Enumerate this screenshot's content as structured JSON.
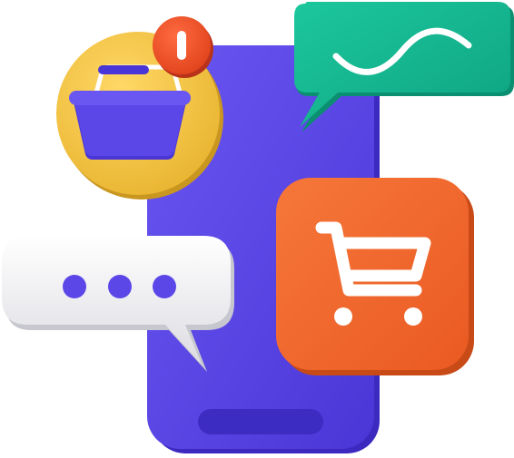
{
  "illustration": {
    "notification_badge": {
      "text": "!"
    },
    "icons": {
      "phone": "smartphone-icon",
      "basket": "shopping-basket-icon",
      "cart": "shopping-cart-icon",
      "chat_typing": "typing-ellipsis-icon",
      "chat_wave": "wave-line-icon",
      "badge": "exclamation-icon"
    },
    "colors": {
      "phone": "#5b47e8",
      "phone_home_bar": "#3d2cc2",
      "basket_circle": "#f2c94c",
      "basket": "#5b47e8",
      "badge": "#f0522a",
      "chat_green": "#13b690",
      "cart_tile": "#f26a2e",
      "chat_white": "#f4f4f6",
      "dots": "#5b47e8"
    }
  }
}
